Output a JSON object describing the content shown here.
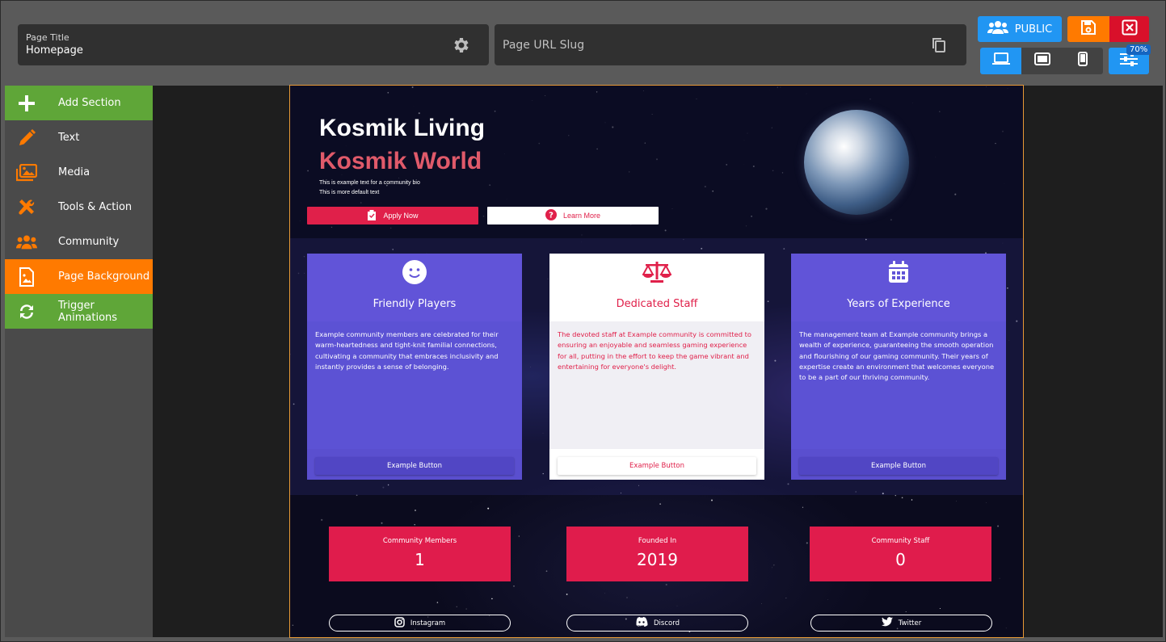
{
  "topbar": {
    "page_title_label": "Page Title",
    "page_title_value": "Homepage",
    "page_url_slug_placeholder": "Page URL Slug",
    "public_label": "PUBLIC",
    "zoom": "70%",
    "colors": {
      "accent_blue": "#2196f3",
      "save_orange": "#ff7a00",
      "close_red": "#d9102a"
    }
  },
  "sidebar": {
    "items": [
      {
        "label": "Add Section",
        "icon": "plus-icon",
        "color": "#5fa638"
      },
      {
        "label": "Text",
        "icon": "pencil-icon"
      },
      {
        "label": "Media",
        "icon": "images-icon"
      },
      {
        "label": "Tools & Action",
        "icon": "tools-icon"
      },
      {
        "label": "Community",
        "icon": "users-icon"
      },
      {
        "label": "Page Background",
        "icon": "image-file-icon",
        "color": "#ff7a00"
      },
      {
        "label": "Trigger Animations",
        "icon": "refresh-icon",
        "color": "#5fa638"
      }
    ]
  },
  "preview": {
    "hero": {
      "title": "Kosmik Living",
      "subtitle": "Kosmik World",
      "bio_line1": "This is example text for a community bio",
      "bio_line2": "This is more default text",
      "apply_button": "Apply Now",
      "learn_button": "Learn More"
    },
    "cards": [
      {
        "title": "Friendly Players",
        "icon": "smile-icon",
        "text": "Example community members are celebrated for their warm-heartedness and tight-knit familial connections, cultivating a community that embraces inclusivity and instantly provides a sense of belonging.",
        "button": "Example Button"
      },
      {
        "title": "Dedicated Staff",
        "icon": "scale-icon",
        "text": "The devoted staff at Example community is committed to ensuring an enjoyable and seamless gaming experience for all, putting in the effort to keep the game vibrant and entertaining for everyone's delight.",
        "button": "Example Button"
      },
      {
        "title": "Years of Experience",
        "icon": "calendar-icon",
        "text": "The management team at Example community brings a wealth of experience, guaranteeing the smooth operation and flourishing of our gaming community. Their years of expertise create an environment that welcomes everyone to be a part of our thriving community.",
        "button": "Example Button"
      }
    ],
    "stats": [
      {
        "label": "Community Members",
        "value": "1"
      },
      {
        "label": "Founded In",
        "value": "2019"
      },
      {
        "label": "Community Staff",
        "value": "0"
      }
    ],
    "socials": [
      {
        "label": "Instagram",
        "icon": "instagram-icon"
      },
      {
        "label": "Discord",
        "icon": "discord-icon"
      },
      {
        "label": "Twitter",
        "icon": "twitter-icon"
      }
    ]
  }
}
